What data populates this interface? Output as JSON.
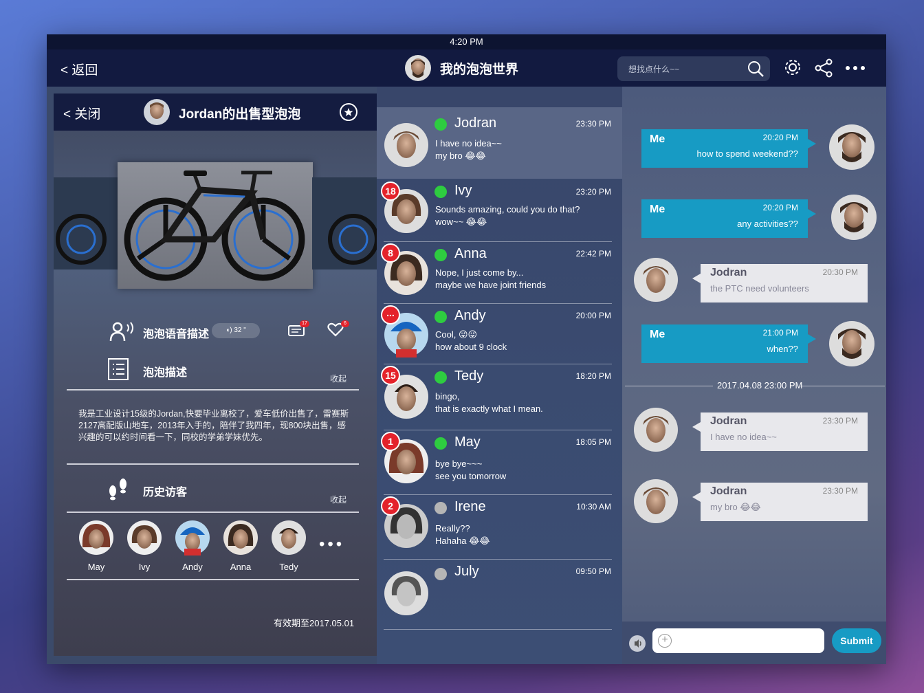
{
  "status_bar": {
    "time": "4:20 PM"
  },
  "top_bar": {
    "back_label": "< 返回",
    "app_title": "我的泡泡世界",
    "search_placeholder": "想找点什么~~"
  },
  "profile_panel": {
    "close_label": "< 关闭",
    "title": "Jordan的出售型泡泡",
    "voice_label": "泡泡语音描述",
    "voice_duration": "32 \"",
    "comment_count": "17",
    "like_count": "6",
    "desc_label": "泡泡描述",
    "desc_fold": "收起",
    "description": "我是工业设计15级的Jordan,快要毕业离校了，爱车低价出售了，雷赛斯2127高配版山地车，2013年入手的，陪伴了我四年，现800块出售，感兴趣的可以约时间看一下，同校的学弟学妹优先。",
    "history_label": "历史访客",
    "history_fold": "收起",
    "visitors": [
      "May",
      "Ivy",
      "Andy",
      "Anna",
      "Tedy"
    ],
    "valid_until": "有效期至2017.05.01"
  },
  "conversations": [
    {
      "name": "Jodran",
      "time": "23:30 PM",
      "line1": "I have no idea~~",
      "line2": "my bro 😂😂",
      "online": true,
      "badge": ""
    },
    {
      "name": "Ivy",
      "time": "23:20 PM",
      "line1": "Sounds amazing, could you do that?",
      "line2": "wow~~ 😂😂",
      "online": true,
      "badge": "18"
    },
    {
      "name": "Anna",
      "time": "22:42 PM",
      "line1": "Nope, I just come by...",
      "line2": "maybe we have joint friends",
      "online": true,
      "badge": "8"
    },
    {
      "name": "Andy",
      "time": "20:00 PM",
      "line1": "Cool, 😜😜",
      "line2": "how about 9 clock",
      "online": true,
      "badge": "..."
    },
    {
      "name": "Tedy",
      "time": "18:20 PM",
      "line1": "bingo,",
      "line2": "that is exactly what I mean.",
      "online": true,
      "badge": "15"
    },
    {
      "name": "May",
      "time": "18:05 PM",
      "line1": "bye bye~~~",
      "line2": "see you tomorrow",
      "online": true,
      "badge": "1"
    },
    {
      "name": "Irene",
      "time": "10:30 AM",
      "line1": "Really??",
      "line2": "Hahaha 😂😂",
      "online": false,
      "badge": "2"
    },
    {
      "name": "July",
      "time": "09:50 PM",
      "line1": "",
      "line2": "",
      "online": false,
      "badge": ""
    }
  ],
  "chat": {
    "messages": [
      {
        "from": "Me",
        "time": "20:20 PM",
        "text": "how to spend weekend??"
      },
      {
        "from": "Me",
        "time": "20:20 PM",
        "text": "any activities??"
      },
      {
        "from": "Jodran",
        "time": "20:30 PM",
        "text": "the PTC need volunteers"
      },
      {
        "from": "Me",
        "time": "21:00 PM",
        "text": "when??"
      },
      {
        "from": "Jodran",
        "time": "23:30 PM",
        "text": "I have no idea~~"
      },
      {
        "from": "Jodran",
        "time": "23:30 PM",
        "text": "my bro 😂😂"
      }
    ],
    "date_separator": "2017.04.08 23:00 PM",
    "submit_label": "Submit"
  },
  "colors": {
    "accent": "#179bc4",
    "online": "#2ecc40",
    "offline": "#b5b5b5",
    "badge": "#e4222b"
  }
}
